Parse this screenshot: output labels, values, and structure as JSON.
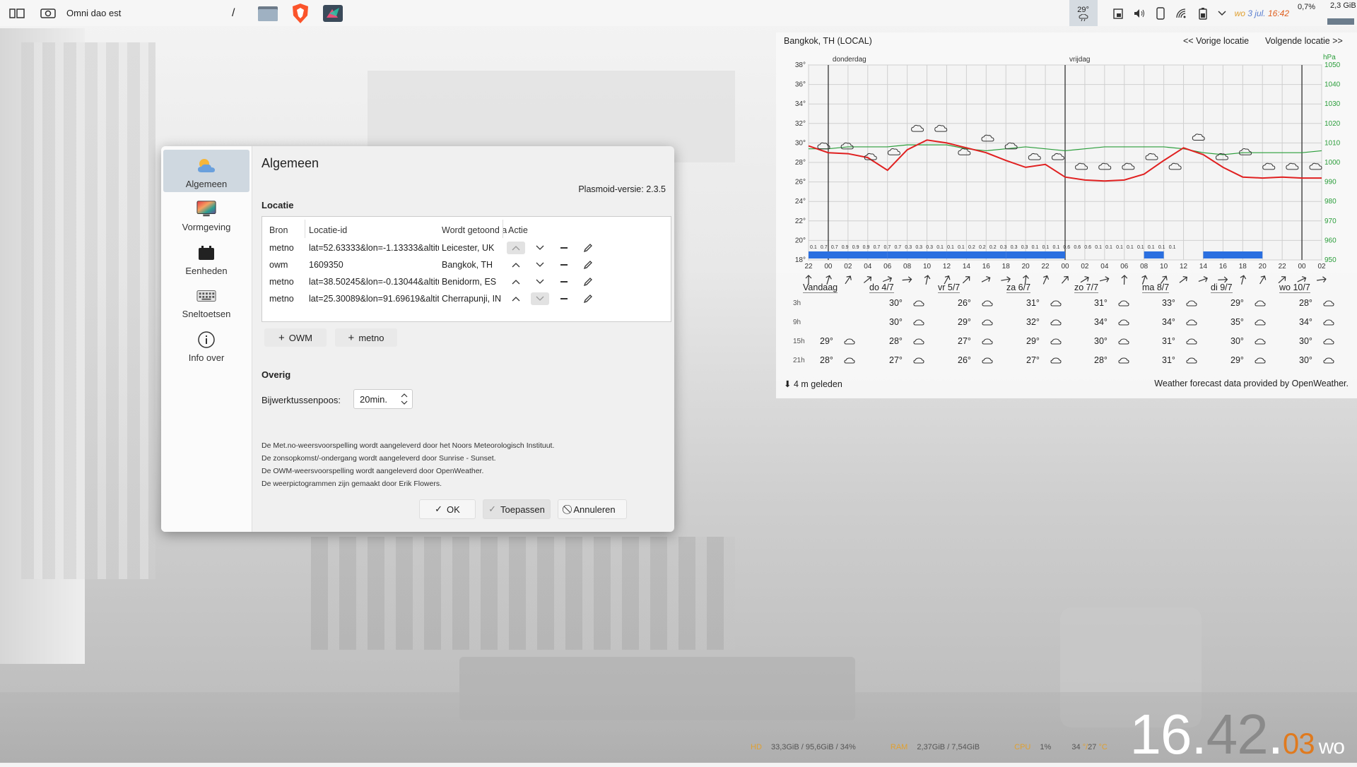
{
  "panel": {
    "window_title": "Omni dao est",
    "separator_text": "/",
    "tray_temp": "29°",
    "date_prefix": "wo",
    "date_day": "3 jul.",
    "time": "16:42",
    "cpu": "0,7%",
    "mem": "2,3 GiB"
  },
  "dialog": {
    "sidebar": [
      {
        "label": "Algemeen",
        "icon": "weather-icon"
      },
      {
        "label": "Vormgeving",
        "icon": "appearance-icon"
      },
      {
        "label": "Eenheden",
        "icon": "units-icon"
      },
      {
        "label": "Sneltoetsen",
        "icon": "keyboard-icon"
      },
      {
        "label": "Info over",
        "icon": "info-icon"
      }
    ],
    "title": "Algemeen",
    "version": "Plasmoid-versie: 2.3.5",
    "location_section": "Locatie",
    "headers": {
      "bron": "Bron",
      "locatie": "Locatie-id",
      "getoond": "Wordt getoond a",
      "actie": "Actie"
    },
    "rows": [
      {
        "bron": "metno",
        "id": "lat=52.63333&lon=-1.13333&altitu...",
        "shown": "Leicester, UK"
      },
      {
        "bron": "owm",
        "id": "1609350",
        "shown": "Bangkok, TH"
      },
      {
        "bron": "metno",
        "id": "lat=38.50245&lon=-0.13044&altitu...",
        "shown": "Benidorm, ES"
      },
      {
        "bron": "metno",
        "id": "lat=25.30089&lon=91.69619&altit...",
        "shown": "Cherrapunji, IN"
      }
    ],
    "add_owm": "OWM",
    "add_metno": "metno",
    "other_section": "Overig",
    "interval_label": "Bijwerktussenpoos:",
    "interval_value": "20min.",
    "notes": [
      "De Met.no-weersvoorspelling wordt aangeleverd door het Noors Meteorologisch Instituut.",
      "De zonsopkomst/-ondergang wordt aangeleverd door Sunrise - Sunset.",
      "De OWM-weersvoorspelling wordt aangeleverd door OpenWeather.",
      "De weerpictogrammen zijn gemaakt door Erik Flowers."
    ],
    "ok": "OK",
    "apply": "Toepassen",
    "cancel": "Annuleren"
  },
  "weather": {
    "location": "Bangkok, TH (LOCAL)",
    "prev": "<< Vorige locatie",
    "next": "Volgende locatie >>",
    "day1": "donderdag",
    "day2": "vrijdag",
    "hpa_unit": "hPa",
    "y_left": [
      "38°",
      "36°",
      "34°",
      "32°",
      "30°",
      "28°",
      "26°",
      "24°",
      "22°",
      "20°",
      "18°"
    ],
    "y_right": [
      "1050",
      "1040",
      "1030",
      "1020",
      "1010",
      "1000",
      "990",
      "980",
      "970",
      "960",
      "950"
    ],
    "hours": [
      "22",
      "00",
      "02",
      "04",
      "06",
      "08",
      "10",
      "12",
      "14",
      "16",
      "18",
      "20",
      "22",
      "00",
      "02",
      "04",
      "06",
      "08",
      "10",
      "12",
      "14",
      "16",
      "18",
      "20",
      "22",
      "00",
      "02"
    ],
    "precip_labels": [
      "0.1",
      "0.7",
      "0.7",
      "0.9",
      "0.9",
      "0.9",
      "0.7",
      "0.7",
      "0.7",
      "0.3",
      "0.3",
      "0.3",
      "0.1",
      "0.1",
      "0.1",
      "0.2",
      "0.2",
      "0.2",
      "0.3",
      "0.3",
      "0.3",
      "0.1",
      "0.1",
      "0.1",
      "0.6",
      "0.6",
      "0.6",
      "0.1",
      "0.1",
      "0.1",
      "0.1",
      "0.1",
      "0.1",
      "0.1",
      "0.1"
    ],
    "days": [
      "Vandaag",
      "do 4/7",
      "vr 5/7",
      "za 6/7",
      "zo 7/7",
      "ma 8/7",
      "di 9/7",
      "wo 10/7"
    ],
    "rows": [
      "3h",
      "9h",
      "15h",
      "21h"
    ],
    "temps": [
      [
        "",
        "30°",
        "26°",
        "31°",
        "31°",
        "33°",
        "29°",
        "28°"
      ],
      [
        "",
        "30°",
        "29°",
        "32°",
        "34°",
        "34°",
        "35°",
        "34°"
      ],
      [
        "29°",
        "28°",
        "27°",
        "29°",
        "30°",
        "31°",
        "30°",
        "30°"
      ],
      [
        "28°",
        "27°",
        "26°",
        "27°",
        "28°",
        "31°",
        "29°",
        "30°"
      ]
    ],
    "updated": "4 m geleden",
    "credit": "Weather forecast data provided by OpenWeather.",
    "chart_data": {
      "type": "line",
      "x": [
        "22",
        "00",
        "02",
        "04",
        "06",
        "08",
        "10",
        "12",
        "14",
        "16",
        "18",
        "20",
        "22",
        "00",
        "02",
        "04",
        "06",
        "08",
        "10",
        "12",
        "14",
        "16",
        "18",
        "20",
        "22",
        "00",
        "02"
      ],
      "series": [
        {
          "values": [
            29.7,
            29.0,
            28.9,
            28.5,
            27.2,
            29.3,
            30.3,
            30.0,
            29.5,
            29.0,
            28.2,
            27.5,
            27.8,
            26.5,
            26.2,
            26.1,
            26.2,
            26.8,
            28.2,
            29.5,
            28.8,
            27.5,
            26.5,
            26.4,
            26.5,
            26.4,
            26.4
          ]
        },
        {
          "values": [
            1007,
            1007,
            1008,
            1008,
            1008,
            1009,
            1009,
            1009,
            1007,
            1006,
            1007,
            1008,
            1007,
            1006,
            1007,
            1008,
            1008,
            1008,
            1008,
            1007,
            1005,
            1004,
            1005,
            1005,
            1005,
            1005,
            1006
          ]
        }
      ],
      "ylim": [
        18,
        38
      ],
      "y2lim": [
        950,
        1050
      ]
    }
  },
  "status": {
    "hd_label": "HD",
    "hd_val": "33,3GiB / 95,6GiB / 34%",
    "ram_label": "RAM",
    "ram_val": "2,37GiB / 7,54GiB",
    "cpu_label": "CPU",
    "cpu_val": "1%",
    "temp_a": "34",
    "temp_b": "27",
    "clock_h": "16",
    "clock_m": "42",
    "clock_s": "03",
    "clock_d": "wo"
  }
}
